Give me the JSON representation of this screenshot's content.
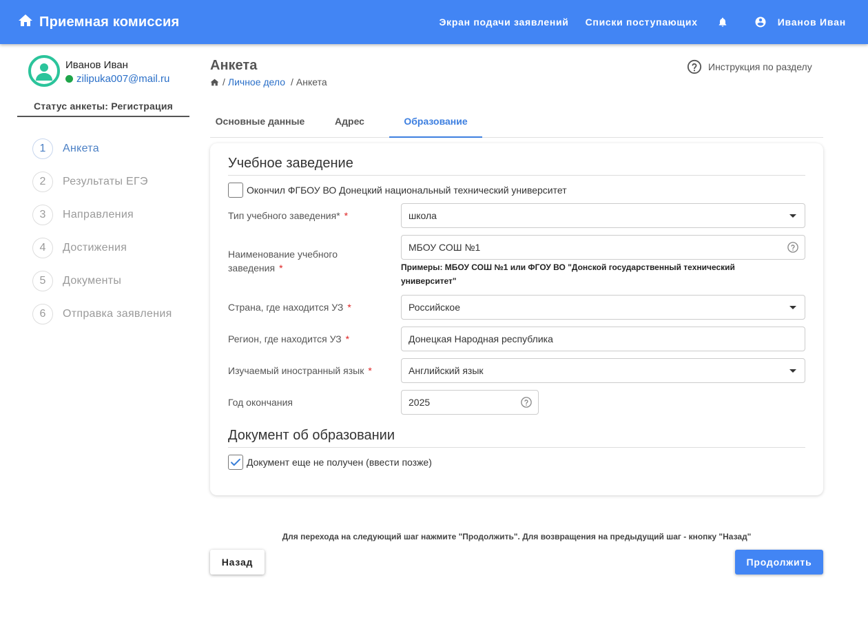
{
  "header": {
    "title": "Приемная комиссия",
    "home_icon": "home-icon",
    "nav": {
      "applications_screen": "Экран подачи заявлений",
      "applicants_lists": "Списки поступающих"
    },
    "bell_icon": "bell-icon",
    "user_icon": "account-circle-icon",
    "user_name": "Иванов Иван",
    "bar_color": "#4285f4"
  },
  "sidebar": {
    "profile": {
      "name": "Иванов Иван",
      "email": "zilipuka007@mail.ru",
      "online_color": "#1fa54a",
      "avatar_color": "#2bc49b"
    },
    "status": "Статус анкеты: Регистрация",
    "steps": [
      {
        "num": "1",
        "label": "Анкета",
        "active": true
      },
      {
        "num": "2",
        "label": "Результаты ЕГЭ"
      },
      {
        "num": "3",
        "label": "Направления"
      },
      {
        "num": "4",
        "label": "Достижения"
      },
      {
        "num": "5",
        "label": "Документы"
      },
      {
        "num": "6",
        "label": "Отправка заявления"
      }
    ]
  },
  "page": {
    "title": "Анкета",
    "breadcrumb": {
      "link": "Личное дело",
      "current": "Анкета",
      "separator": "/"
    },
    "help_text": "Инструкция по разделу"
  },
  "tabs": [
    {
      "label": "Основные данные"
    },
    {
      "label": "Адрес"
    },
    {
      "label": "Образование",
      "active": true
    }
  ],
  "form": {
    "institution_section_title": "Учебное заведение",
    "graduated_checkbox": {
      "label": "Окончил ФГБОУ ВО Донецкий национальный технический университет",
      "checked": false
    },
    "institution_type": {
      "label": "Тип учебного заведения*",
      "required_mark": "*",
      "value": "школа"
    },
    "institution_name": {
      "label_line1": "Наименование учебного",
      "label_line2": "заведения",
      "required_mark": "*",
      "value": "МБОУ СОШ №1",
      "hint": "Примеры: МБОУ СОШ №1 или ФГОУ ВО \"Донской государственный технический университет\""
    },
    "country": {
      "label": "Страна, где находится УЗ",
      "required_mark": "*",
      "value": "Российское"
    },
    "region": {
      "label": "Регион, где находится УЗ",
      "required_mark": "*",
      "value": "Донецкая Народная республика"
    },
    "foreign_language": {
      "label": "Изучаемый иностранный язык",
      "required_mark": "*",
      "value": "Английский язык"
    },
    "graduation_year": {
      "label": "Год окончания",
      "value": "2025"
    },
    "document_section_title": "Документ об образовании",
    "document_checkbox": {
      "label": "Документ еще не получен (ввести позже)",
      "checked": true
    }
  },
  "footer": {
    "note": "Для перехода на следующий шаг нажмите \"Продолжить\". Для возвращения на предыдущий шаг - кнопку \"Назад\"",
    "back_label": "Назад",
    "next_label": "Продолжить"
  }
}
